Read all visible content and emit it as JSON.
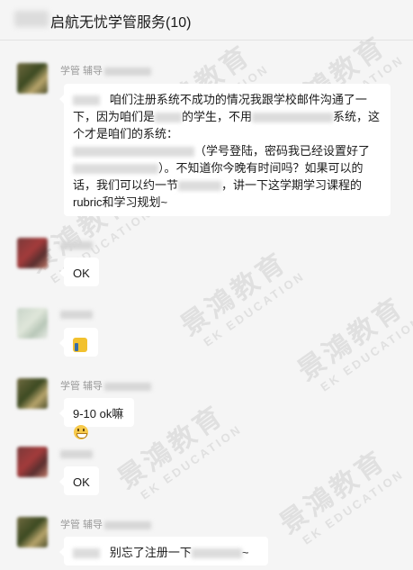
{
  "header": {
    "title": "启航无忧学管服务(10)"
  },
  "watermark": {
    "text_cn": "景鴻教育",
    "text_en": "EK EDUCATION"
  },
  "messages": [
    {
      "sender": "学管  辅导",
      "parts": [
        "咱们注册系统不成功的情况我跟学校邮件沟通了一下，因为咱们是",
        "的学生，不用",
        "系统，这个才是咱们的系统：",
        "（学号登陆，密码我已经设置好了",
        "）。不知道你今晚有时间吗？如果可以的话，我们可以约一节",
        "，讲一下这学期学习课程的rubric和学习规划~"
      ]
    },
    {
      "sender": "",
      "text": "OK"
    },
    {
      "sender": "",
      "icon": "thumbs-up-icon"
    },
    {
      "sender": "学管  辅导",
      "text": "9-10 ok嘛",
      "icon": "grinning-face-icon"
    },
    {
      "sender": "",
      "text": "OK"
    },
    {
      "sender": "学管  辅导",
      "parts": [
        "别忘了注册一下",
        "~"
      ]
    }
  ]
}
